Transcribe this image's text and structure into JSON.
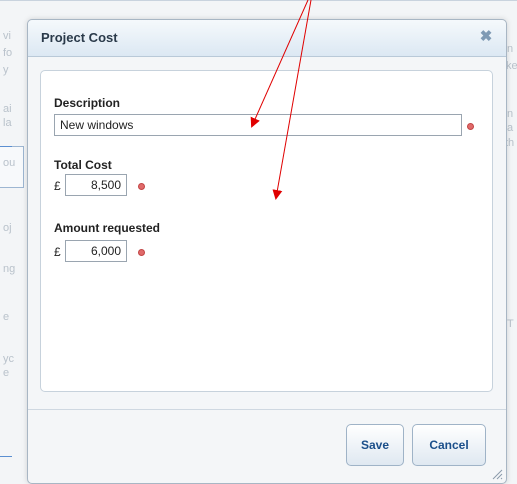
{
  "background": {
    "fragments": [
      "vi",
      "fo",
      "y",
      "ai",
      "la",
      "ou",
      "oj",
      "ng",
      "e",
      "yc",
      "e",
      "n",
      "ke",
      "n",
      "a",
      "th",
      "T"
    ]
  },
  "dialog": {
    "title": "Project Cost",
    "close_icon": "close-icon",
    "description": {
      "label": "Description",
      "value": "New windows"
    },
    "total_cost": {
      "label": "Total Cost",
      "currency": "£",
      "value": "8,500"
    },
    "amount_requested": {
      "label": "Amount requested",
      "currency": "£",
      "value": "6,000"
    },
    "buttons": {
      "save": "Save",
      "cancel": "Cancel"
    }
  },
  "colors": {
    "annotation_arrow": "#e00000",
    "required_marker": "#e06a6a",
    "button_text": "#1b4f8a"
  }
}
